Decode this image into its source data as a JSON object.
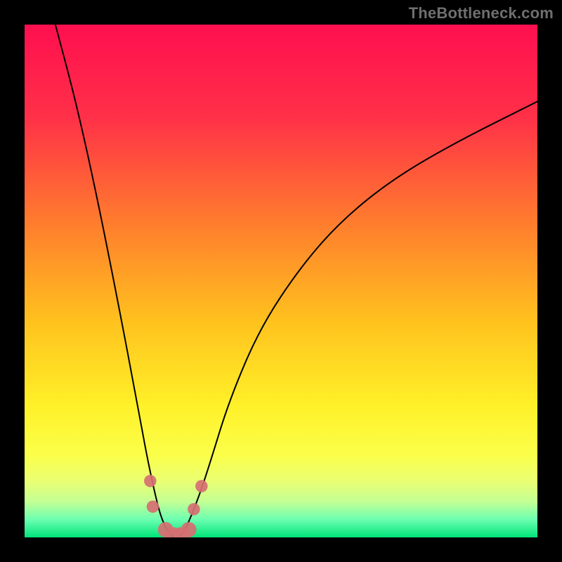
{
  "watermark": "TheBottleneck.com",
  "chart_data": {
    "type": "line",
    "title": "",
    "xlabel": "",
    "ylabel": "",
    "xlim": [
      0,
      100
    ],
    "ylim": [
      0,
      100
    ],
    "grid": false,
    "legend": false,
    "series": [
      {
        "name": "curve",
        "color": "#000000",
        "x": [
          6,
          10,
          14,
          18,
          22,
          24,
          26,
          27,
          28,
          29,
          30,
          31,
          32,
          34,
          36,
          40,
          46,
          54,
          62,
          72,
          84,
          100
        ],
        "y": [
          100,
          85,
          67,
          47,
          26,
          15,
          6,
          3,
          1,
          0,
          0,
          1,
          3,
          8,
          14,
          27,
          41,
          53,
          62,
          70,
          77,
          85
        ]
      }
    ],
    "markers": [
      {
        "x": 24.5,
        "y": 11,
        "r": 1.2
      },
      {
        "x": 25.0,
        "y": 6,
        "r": 1.2
      },
      {
        "x": 27.5,
        "y": 1.5,
        "r": 1.5
      },
      {
        "x": 29.0,
        "y": 0.5,
        "r": 1.5
      },
      {
        "x": 30.5,
        "y": 0.5,
        "r": 1.5
      },
      {
        "x": 32.0,
        "y": 1.5,
        "r": 1.5
      },
      {
        "x": 33.0,
        "y": 5.5,
        "r": 1.2
      },
      {
        "x": 34.5,
        "y": 10,
        "r": 1.2
      }
    ],
    "background": {
      "type": "vertical-gradient",
      "stops": [
        {
          "offset": 0.0,
          "color": "#ff0f4f"
        },
        {
          "offset": 0.18,
          "color": "#ff3048"
        },
        {
          "offset": 0.38,
          "color": "#ff7a2e"
        },
        {
          "offset": 0.58,
          "color": "#ffc21e"
        },
        {
          "offset": 0.74,
          "color": "#fff028"
        },
        {
          "offset": 0.84,
          "color": "#fbff4a"
        },
        {
          "offset": 0.89,
          "color": "#eaff72"
        },
        {
          "offset": 0.93,
          "color": "#c4ff94"
        },
        {
          "offset": 0.965,
          "color": "#6cffb0"
        },
        {
          "offset": 1.0,
          "color": "#00e47a"
        }
      ]
    }
  }
}
